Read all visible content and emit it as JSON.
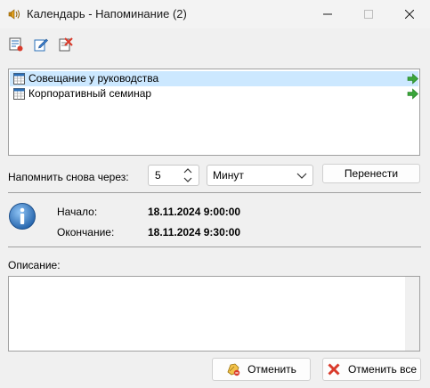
{
  "window": {
    "title": "Календарь - Напоминание (2)",
    "controls": [
      "minimize",
      "maximize",
      "close"
    ]
  },
  "toolbar": {
    "buttons": [
      {
        "icon": "checklist-icon"
      },
      {
        "icon": "edit-icon"
      },
      {
        "icon": "delete-icon"
      }
    ]
  },
  "reminders": {
    "items": [
      {
        "label": "Совещание у руководства",
        "selected": true
      },
      {
        "label": "Корпоративный семинар",
        "selected": false
      }
    ]
  },
  "snooze": {
    "label": "Напомнить снова через:",
    "value": "5",
    "unit": "Минут",
    "button_label": "Перенести"
  },
  "details": {
    "start_label": "Начало:",
    "start_value": "18.11.2024 9:00:00",
    "end_label": "Окончание:",
    "end_value": "18.11.2024 9:30:00"
  },
  "description": {
    "label": "Описание:",
    "value": ""
  },
  "footer": {
    "cancel_label": "Отменить",
    "cancel_all_label": "Отменить все"
  },
  "colors": {
    "selection": "#cce8ff",
    "window_bg": "#f0f0f0",
    "info_blue": "#2a6fb8",
    "arrow_green": "#3aa53a",
    "cancel_red": "#d93a2b"
  }
}
